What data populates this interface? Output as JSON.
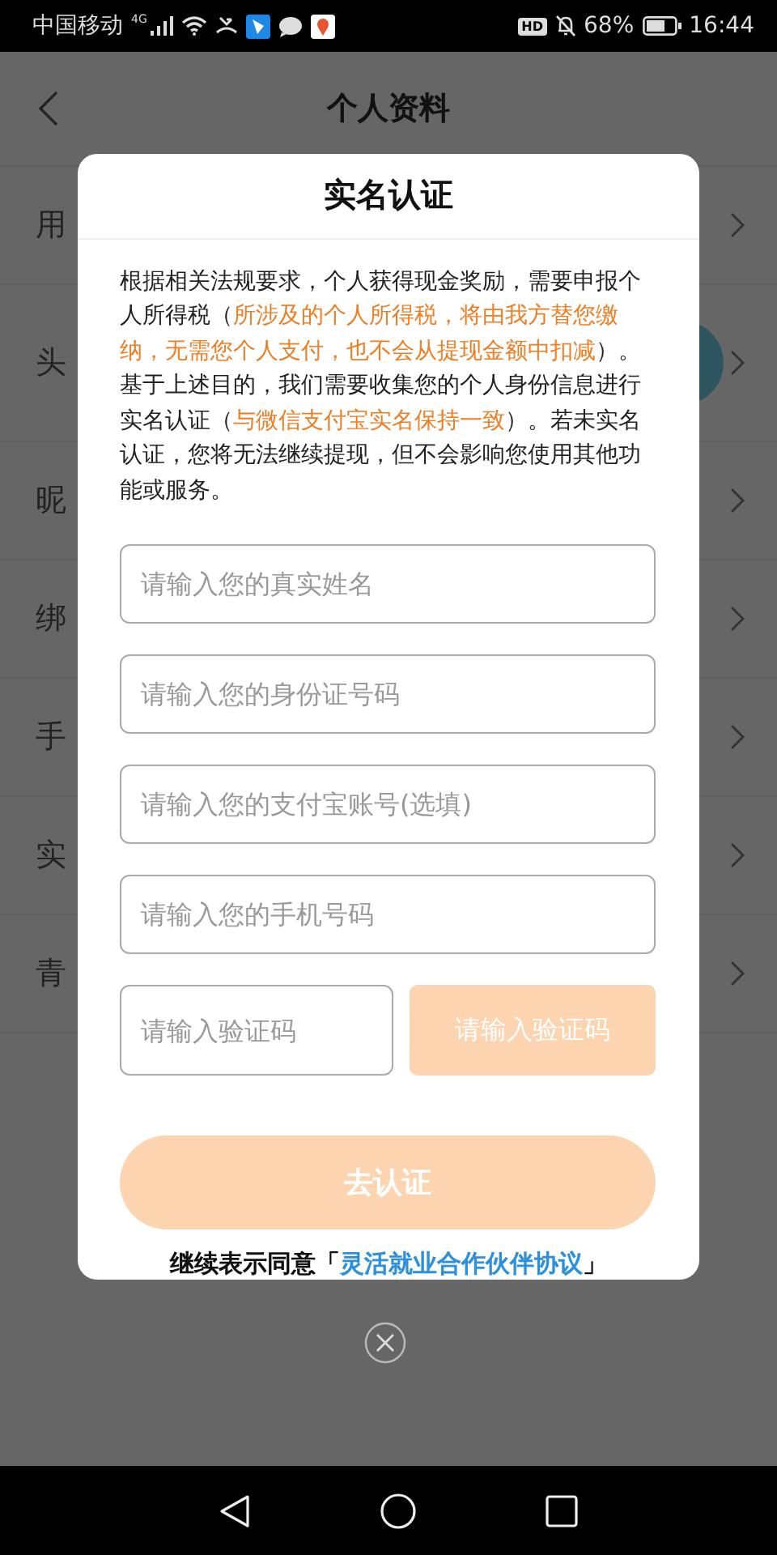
{
  "status_bar": {
    "carrier": "中国移动",
    "network": "4G",
    "hd": "HD",
    "battery_text": "68%",
    "time": "16:44"
  },
  "header": {
    "title": "个人资料"
  },
  "rows": [
    {
      "label": "用",
      "kind": "text"
    },
    {
      "label": "头",
      "kind": "avatar"
    },
    {
      "label": "昵",
      "kind": "text"
    },
    {
      "label": "绑",
      "kind": "text"
    },
    {
      "label": "手",
      "kind": "text"
    },
    {
      "label": "实",
      "kind": "text"
    },
    {
      "label": "青",
      "kind": "text"
    }
  ],
  "dialog": {
    "title": "实名认证",
    "notice": [
      {
        "text": "根据相关法规要求，个人获得现金奖励，需要申报个人所得税（",
        "highlight": false
      },
      {
        "text": "所涉及的个人所得税，将由我方替您缴纳，无需您个人支付，也不会从提现金额中扣减",
        "highlight": true
      },
      {
        "text": "）。基于上述目的，我们需要收集您的个人身份信息进行实名认证（",
        "highlight": false
      },
      {
        "text": "与微信支付宝实名保持一致",
        "highlight": true
      },
      {
        "text": "）。若未实名认证，您将无法继续提现，但不会影响您使用其他功能或服务。",
        "highlight": false
      }
    ],
    "fields": [
      {
        "placeholder": "请输入您的真实姓名"
      },
      {
        "placeholder": "请输入您的身份证号码"
      },
      {
        "placeholder": "请输入您的支付宝账号(选填)"
      },
      {
        "placeholder": "请输入您的手机号码"
      }
    ],
    "code_field": {
      "placeholder": "请输入验证码"
    },
    "code_button": {
      "label": "请输入验证码",
      "disabled": true
    },
    "submit_button": {
      "label": "去认证",
      "disabled": true
    },
    "agreement": {
      "prefix": "继续表示同意「",
      "link": "灵活就业合作伙伴协议",
      "suffix": "」"
    }
  }
}
